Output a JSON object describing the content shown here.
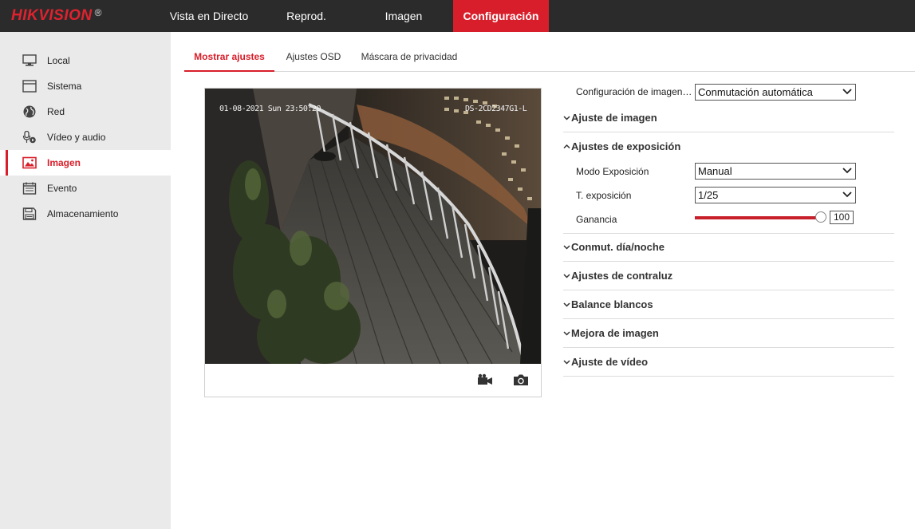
{
  "brand": {
    "logo_text": "HIKVISION",
    "registered": "®"
  },
  "nav": {
    "live": "Vista en Directo",
    "playback": "Reprod.",
    "image": "Imagen",
    "config": "Configuración"
  },
  "sidebar": {
    "items": [
      {
        "label": "Local",
        "icon": "monitor-icon"
      },
      {
        "label": "Sistema",
        "icon": "window-icon"
      },
      {
        "label": "Red",
        "icon": "globe-icon"
      },
      {
        "label": "Vídeo y audio",
        "icon": "microphone-icon"
      },
      {
        "label": "Imagen",
        "icon": "image-icon"
      },
      {
        "label": "Evento",
        "icon": "calendar-icon"
      },
      {
        "label": "Almacenamiento",
        "icon": "floppy-icon"
      }
    ],
    "active_index": 4
  },
  "tabs": {
    "display": "Mostrar ajustes",
    "osd": "Ajustes OSD",
    "privacy": "Máscara de privacidad"
  },
  "video": {
    "osd_datetime": "01-08-2021 Sun 23:50:20",
    "osd_camera": "DS-2CD2347G1-L"
  },
  "settings": {
    "image_config_label": "Configuración de imagen…",
    "image_config_value": "Conmutación automática",
    "sections": {
      "image_adjust": "Ajuste de imagen",
      "exposure": "Ajustes de exposición",
      "day_night": "Conmut. día/noche",
      "backlight": "Ajustes de contraluz",
      "white_balance": "Balance blancos",
      "enhancement": "Mejora de imagen",
      "video_adjust": "Ajuste de vídeo"
    },
    "exposure_mode_label": "Modo Exposición",
    "exposure_mode_value": "Manual",
    "exposure_time_label": "T. exposición",
    "exposure_time_value": "1/25",
    "gain_label": "Ganancia",
    "gain_value": "100",
    "gain_fraction": 1.0
  },
  "colors": {
    "accent": "#d81e2a",
    "topbar": "#2b2b2b",
    "sidebar": "#eaeaea"
  }
}
